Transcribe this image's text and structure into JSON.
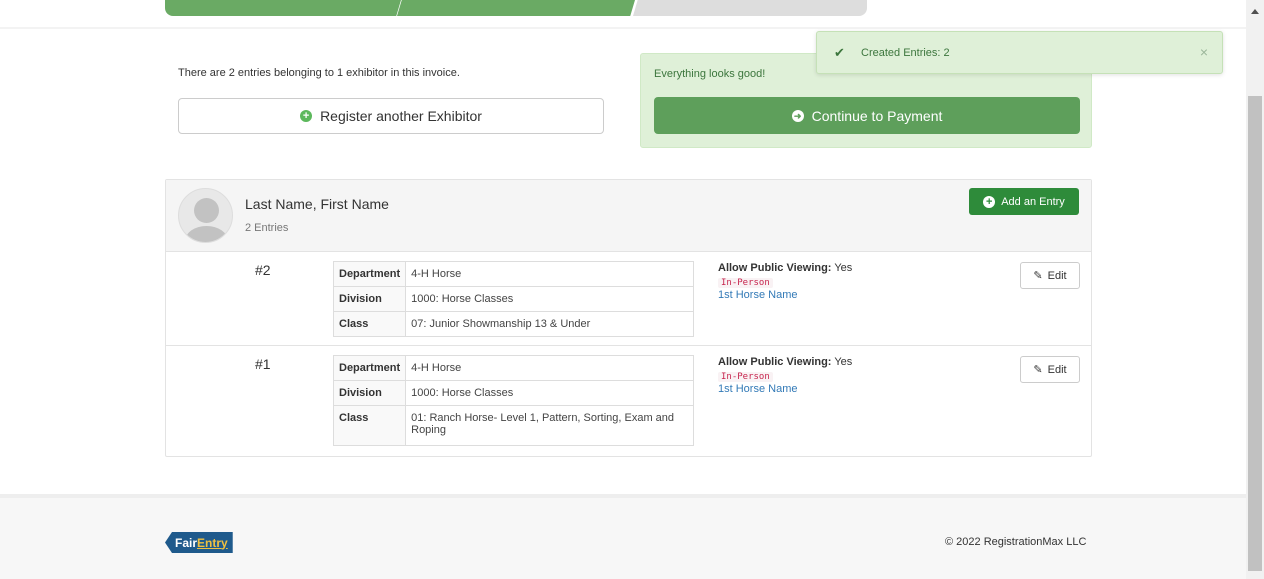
{
  "summary": {
    "text": "There are 2 entries belonging to 1 exhibitor in this invoice."
  },
  "actions": {
    "register_label": "Register another Exhibitor",
    "status_text": "Everything looks good!",
    "continue_label": "Continue to Payment"
  },
  "toast": {
    "message": "Created Entries: 2",
    "close": "×"
  },
  "exhibitor": {
    "name": "Last Name, First Name",
    "entries_count": "2 Entries",
    "add_entry_label": "Add an Entry"
  },
  "entries": [
    {
      "number": "#2",
      "rows": [
        {
          "label": "Department",
          "value": "4-H Horse"
        },
        {
          "label": "Division",
          "value": "1000: Horse Classes"
        },
        {
          "label": "Class",
          "value": "07: Junior Showmanship 13 & Under"
        }
      ],
      "public_label": "Allow Public Viewing:",
      "public_value": "Yes",
      "mode": "In-Person",
      "horse": "1st Horse Name",
      "edit_label": "Edit"
    },
    {
      "number": "#1",
      "rows": [
        {
          "label": "Department",
          "value": "4-H Horse"
        },
        {
          "label": "Division",
          "value": "1000: Horse Classes"
        },
        {
          "label": "Class",
          "value": "01: Ranch Horse- Level 1, Pattern, Sorting, Exam and Roping"
        }
      ],
      "public_label": "Allow Public Viewing:",
      "public_value": "Yes",
      "mode": "In-Person",
      "horse": "1st Horse Name",
      "edit_label": "Edit"
    }
  ],
  "footer": {
    "logo_part1": "Fair",
    "logo_part2": "Entry",
    "copyright": "© 2022 RegistrationMax LLC"
  },
  "colors": {
    "success": "#5cb85c",
    "primary_green": "#5e9f5b",
    "dark_green": "#2e8b3a",
    "link": "#337ab7",
    "alert_bg": "#dff0d8"
  },
  "icons": {
    "register": "plus-circle-icon",
    "continue": "arrow-circle-right-icon",
    "toast": "check-icon",
    "add_entry": "plus-circle-icon",
    "edit": "pencil-icon"
  }
}
